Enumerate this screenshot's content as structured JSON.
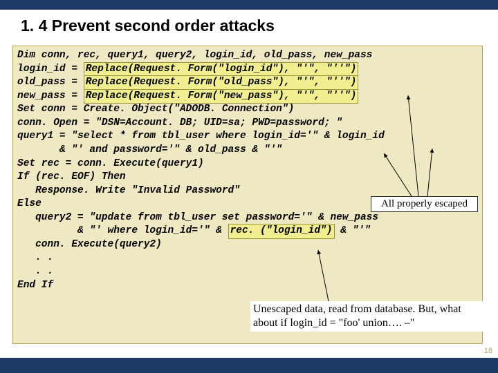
{
  "title": "1. 4 Prevent second order attacks",
  "code": {
    "l1": "Dim conn, rec, query1, query2, login_id, old_pass, new_pass",
    "l2a": "login_id = ",
    "l2b": "Replace(Request. Form(\"login_id\"), \"'\", \"''\")",
    "l3a": "old_pass = ",
    "l3b": "Replace(Request. Form(\"old_pass\"), \"'\", \"''\")",
    "l4a": "new_pass = ",
    "l4b": "Replace(Request. Form(\"new_pass\"), \"'\", \"''\")",
    "l5": "Set conn = Create. Object(\"ADODB. Connection\")",
    "l6": "conn. Open = \"DSN=Account. DB; UID=sa; PWD=password; \"",
    "l7": "query1 = \"select * from tbl_user where login_id='\" & login_id",
    "l8": "       & \"' and password='\" & old_pass & \"'\"",
    "l9": "Set rec = conn. Execute(query1)",
    "l10": "If (rec. EOF) Then",
    "l11": "   Response. Write \"Invalid Password\"",
    "l12": "Else",
    "l13": "   query2 = \"update from tbl_user set password='\" & new_pass",
    "l14a": "          & \"' where login_id='\" & ",
    "l14b": "rec. (\"login_id\")",
    "l14c": " & \"'\"",
    "l15": "   conn. Execute(query2)",
    "l16": "   . .",
    "l17": "   . .",
    "l18": "End If"
  },
  "callouts": {
    "escaped": "All properly escaped",
    "unescaped": "Unescaped data, read from database.\nBut, what about if\nlogin_id = \"foo' union…. –\""
  },
  "page": "18"
}
